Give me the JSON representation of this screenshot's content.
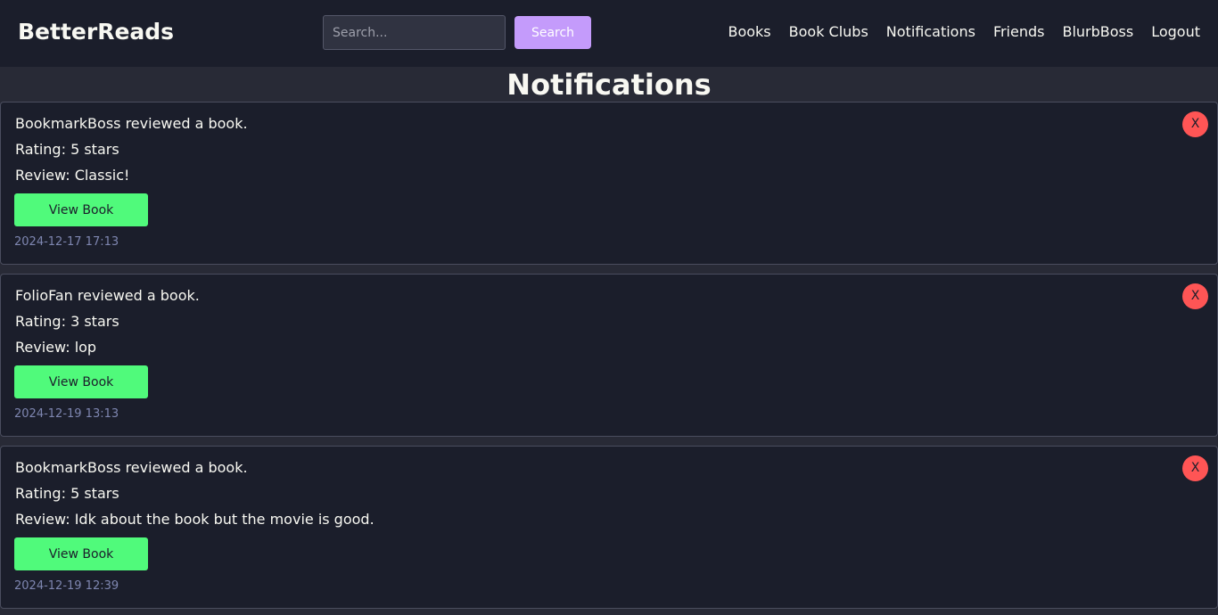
{
  "header": {
    "brand": "BetterReads",
    "search": {
      "placeholder": "Search...",
      "value": "",
      "button_label": "Search"
    },
    "nav": [
      "Books",
      "Book Clubs",
      "Notifications",
      "Friends",
      "BlurbBoss",
      "Logout"
    ]
  },
  "page_title": "Notifications",
  "notifications": [
    {
      "message": "BookmarkBoss reviewed a book.",
      "rating": "Rating: 5 stars",
      "review": "Review: Classic!",
      "button_label": "View Book",
      "timestamp": "2024-12-17 17:13",
      "close_label": "X"
    },
    {
      "message": "FolioFan reviewed a book.",
      "rating": "Rating: 3 stars",
      "review": "Review: lop",
      "button_label": "View Book",
      "timestamp": "2024-12-19 13:13",
      "close_label": "X"
    },
    {
      "message": "BookmarkBoss reviewed a book.",
      "rating": "Rating: 5 stars",
      "review": "Review: Idk about the book but the movie is good.",
      "button_label": "View Book",
      "timestamp": "2024-12-19 12:39",
      "close_label": "X"
    }
  ],
  "colors": {
    "background": "#282a36",
    "surface": "#1b1e2b",
    "accent": "#c49bfb",
    "view_button": "#50fa7b",
    "close_button": "#ff5555",
    "timestamp": "#7e86b0"
  }
}
